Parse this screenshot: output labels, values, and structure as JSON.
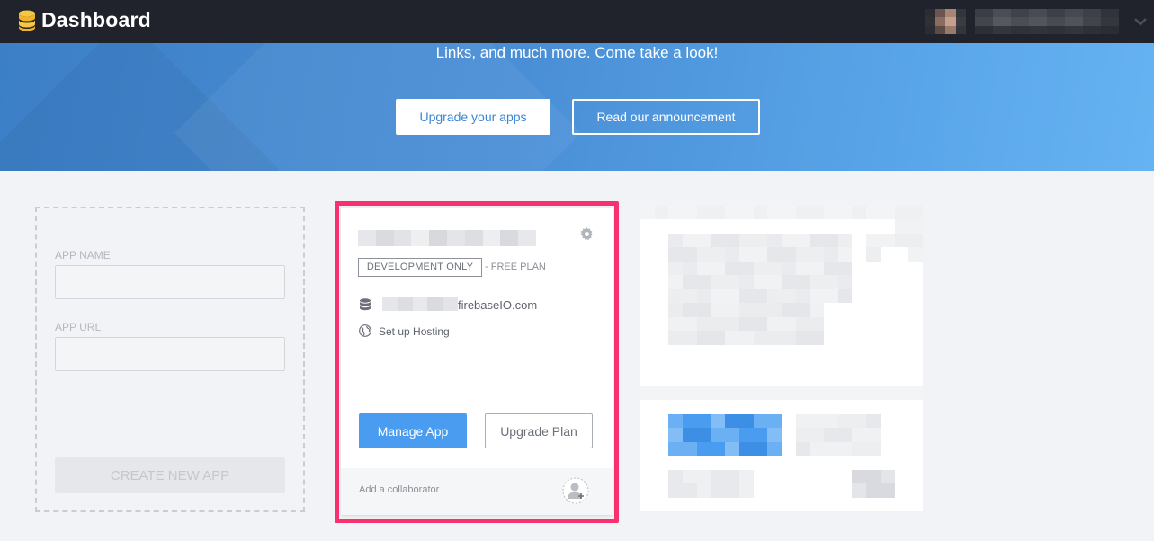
{
  "app": {
    "title": "Dashboard",
    "logo_icon": "database-stack-icon"
  },
  "user_menu": {
    "chevron_icon": "chevron-down-icon"
  },
  "hero": {
    "text": "Links, and much more. Come take a look!",
    "upgrade_button": "Upgrade your apps",
    "announcement_button": "Read our announcement"
  },
  "create_app": {
    "app_name_label": "APP NAME",
    "app_name_value": "",
    "app_url_label": "APP URL",
    "app_url_value": "",
    "create_button": "CREATE NEW APP"
  },
  "app_card": {
    "badge": "DEVELOPMENT ONLY",
    "plan": "- FREE PLAN",
    "url_suffix": "firebaseIO.com",
    "hosting_label": "Set up Hosting",
    "manage_button": "Manage App",
    "upgrade_button": "Upgrade Plan",
    "collaborator_label": "Add a collaborator",
    "highlight_color": "#f8306f"
  },
  "colors": {
    "topbar": "#20232b",
    "primary": "#4a9cf0",
    "hero_start": "#3c7fc7",
    "hero_end": "#66b3f2"
  }
}
